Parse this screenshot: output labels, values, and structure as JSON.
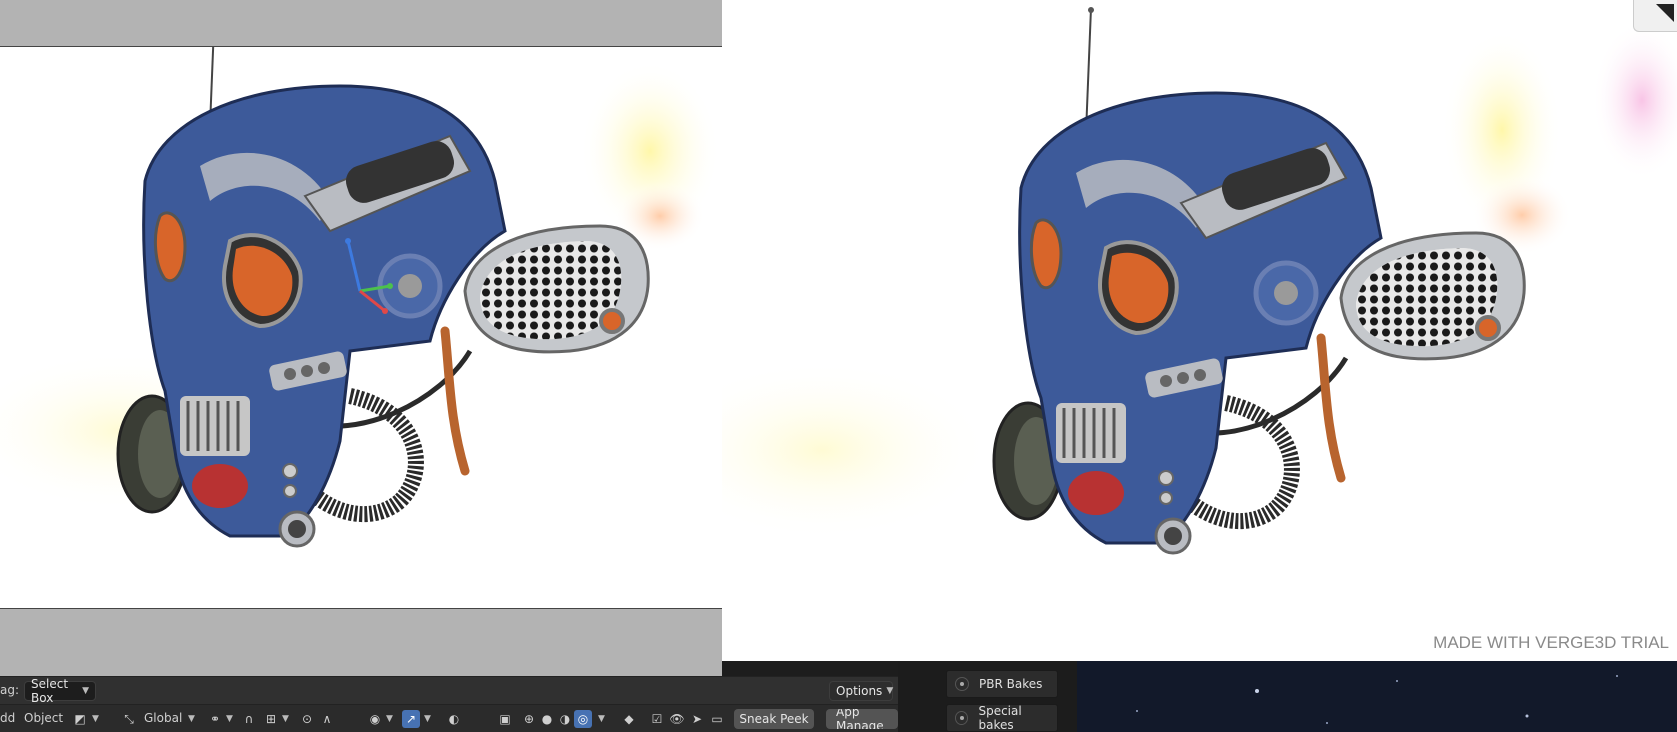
{
  "preview": {
    "watermark": "MADE WITH VERGE3D TRIAL"
  },
  "side_panel": {
    "buttons": [
      {
        "label": "PBR Bakes"
      },
      {
        "label": "Special bakes"
      }
    ]
  },
  "toolbar_top": {
    "drag_label": "ag:",
    "select_mode": "Select Box",
    "options_label": "Options"
  },
  "toolbar_bottom": {
    "add_label": "dd",
    "object_label": "Object",
    "orientation": "Global",
    "sneak_peek_label": "Sneak Peek",
    "app_manager_label": "App Manage"
  },
  "colors": {
    "helmet_blue": "#3d5a9a",
    "metal": "#b9bcc2",
    "visor_orange": "#d8652a",
    "accent_blue": "#4772b3"
  },
  "icons": [
    "orientation-icon",
    "pivot-icon",
    "snap-icon",
    "proportional-icon",
    "visibility-icon",
    "gizmo-icon",
    "overlay-icon",
    "xray-icon",
    "shading-wireframe-icon",
    "shading-solid-icon",
    "shading-material-icon",
    "shading-rendered-icon",
    "checkbox-icon",
    "eye-icon",
    "cursor-icon",
    "screen-icon"
  ]
}
